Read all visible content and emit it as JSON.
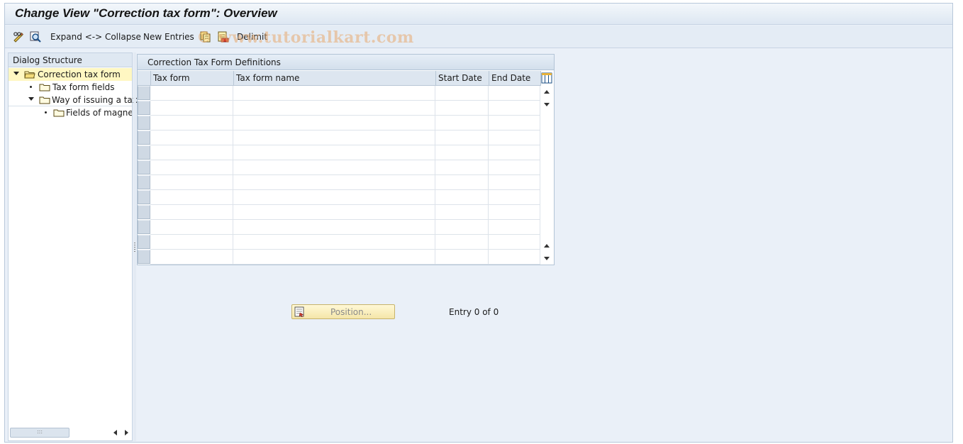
{
  "window": {
    "title": "Change View \"Correction tax form\": Overview"
  },
  "toolbar": {
    "expand_collapse_label": "Expand <-> Collapse",
    "new_entries_label": "New Entries",
    "delimit_label": "Delimit",
    "watermark": "© www.tutorialkart.com"
  },
  "dialog_structure": {
    "header": "Dialog Structure",
    "items": [
      {
        "label": "Correction tax form",
        "expanded": true,
        "selected": true
      },
      {
        "label": "Tax form fields",
        "expanded": false,
        "selected": false
      },
      {
        "label": "Way of issuing a tax",
        "expanded": true,
        "selected": false
      },
      {
        "label": "Fields of magneti",
        "expanded": false,
        "selected": false
      }
    ]
  },
  "table": {
    "title": "Correction Tax Form Definitions",
    "columns": [
      "Tax form",
      "Tax form name",
      "Start Date",
      "End Date"
    ],
    "rows": [
      [
        "",
        "",
        "",
        ""
      ],
      [
        "",
        "",
        "",
        ""
      ],
      [
        "",
        "",
        "",
        ""
      ],
      [
        "",
        "",
        "",
        ""
      ],
      [
        "",
        "",
        "",
        ""
      ],
      [
        "",
        "",
        "",
        ""
      ],
      [
        "",
        "",
        "",
        ""
      ],
      [
        "",
        "",
        "",
        ""
      ],
      [
        "",
        "",
        "",
        ""
      ],
      [
        "",
        "",
        "",
        ""
      ],
      [
        "",
        "",
        "",
        ""
      ],
      [
        "",
        "",
        "",
        ""
      ]
    ]
  },
  "footer": {
    "position_button_label": "Position...",
    "entry_text": "Entry 0 of 0"
  },
  "colors": {
    "background": "#eaf0f8",
    "selected_tree_item": "#fff7c2",
    "position_button": "#f5e6a8",
    "watermark": "#e8aa6e"
  }
}
